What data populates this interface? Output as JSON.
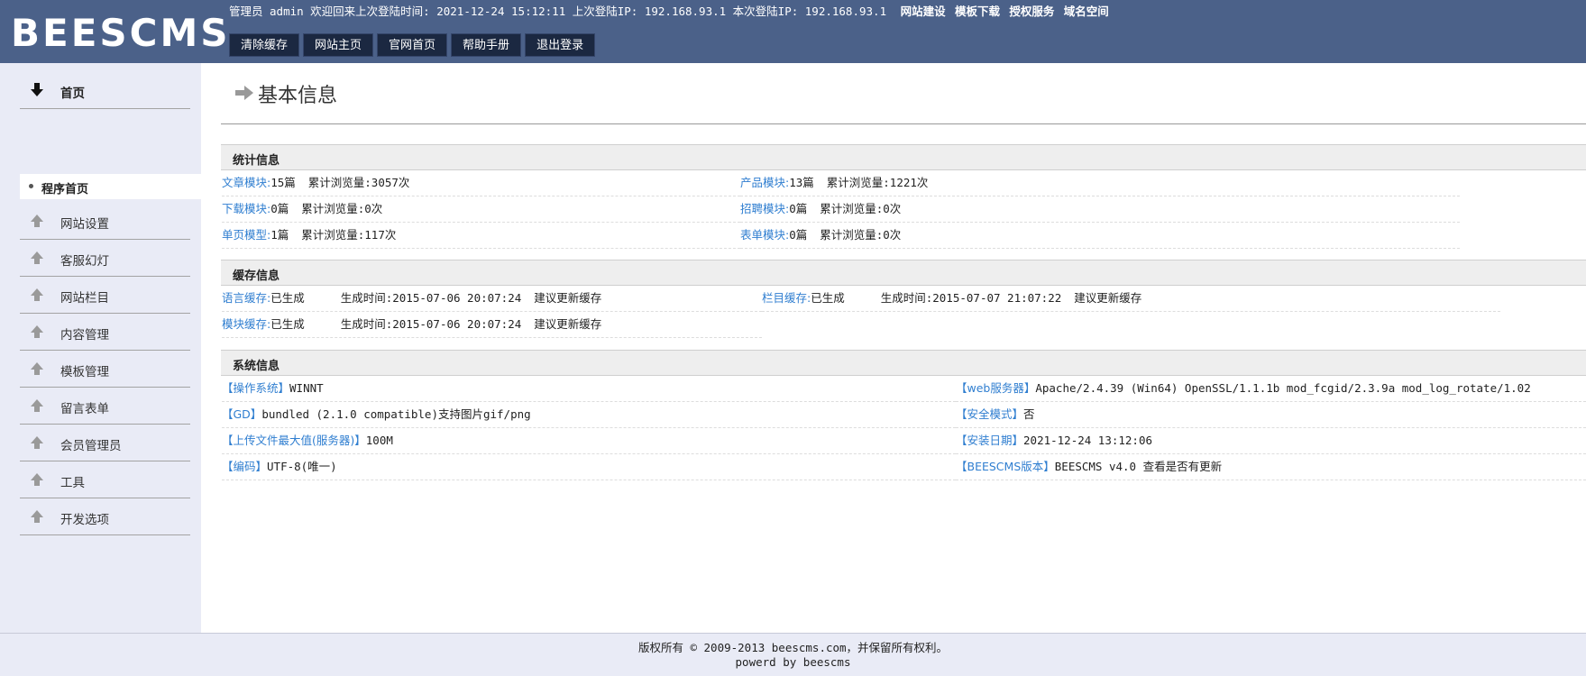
{
  "header": {
    "logo": "BEESCMS",
    "login_info": "管理员 admin 欢迎回来上次登陆时间: 2021-12-24 15:12:11 上次登陆IP: 192.168.93.1 本次登陆IP: 192.168.93.1",
    "links": [
      "网站建设",
      "模板下载",
      "授权服务",
      "域名空间"
    ],
    "buttons": [
      "清除缓存",
      "网站主页",
      "官网首页",
      "帮助手册",
      "退出登录"
    ]
  },
  "sidebar": {
    "home": "首页",
    "sub": "程序首页",
    "items": [
      "网站设置",
      "客服幻灯",
      "网站栏目",
      "内容管理",
      "模板管理",
      "留言表单",
      "会员管理员",
      "工具",
      "开发选项"
    ]
  },
  "main": {
    "title": "基本信息",
    "stats": {
      "heading": "统计信息",
      "rows": [
        {
          "k": "文章模块:",
          "count": "15篇",
          "views": "累计浏览量:3057次"
        },
        {
          "k": "产品模块:",
          "count": "13篇",
          "views": "累计浏览量:1221次"
        },
        {
          "k": "下载模块:",
          "count": "0篇",
          "views": "累计浏览量:0次"
        },
        {
          "k": "招聘模块:",
          "count": "0篇",
          "views": "累计浏览量:0次"
        },
        {
          "k": "单页模型:",
          "count": "1篇",
          "views": "累计浏览量:117次"
        },
        {
          "k": "表单模块:",
          "count": "0篇",
          "views": "累计浏览量:0次"
        }
      ]
    },
    "cache": {
      "heading": "缓存信息",
      "rows": [
        {
          "k": "语言缓存:",
          "status": "已生成",
          "time": "生成时间:2015-07-06 20:07:24",
          "tip": "建议更新缓存"
        },
        {
          "k": "栏目缓存:",
          "status": "已生成",
          "time": "生成时间:2015-07-07 21:07:22",
          "tip": "建议更新缓存"
        },
        {
          "k": "模块缓存:",
          "status": "已生成",
          "time": "生成时间:2015-07-06 20:07:24",
          "tip": "建议更新缓存"
        }
      ]
    },
    "system": {
      "heading": "系统信息",
      "rows": [
        {
          "k": "【操作系统】",
          "v": "WINNT"
        },
        {
          "k": "【web服务器】",
          "v": "Apache/2.4.39 (Win64) OpenSSL/1.1.1b mod_fcgid/2.3.9a mod_log_rotate/1.02"
        },
        {
          "k": "【GD】",
          "v": "bundled (2.1.0 compatible)支持图片gif/png"
        },
        {
          "k": "【安全模式】",
          "v": "否"
        },
        {
          "k": "【上传文件最大值(服务器)】",
          "v": "100M"
        },
        {
          "k": "【安装日期】",
          "v": "2021-12-24 13:12:06"
        },
        {
          "k": "【编码】",
          "v": "UTF-8(唯一)"
        },
        {
          "k": "【BEESCMS版本】",
          "v": "BEESCMS v4.0  查看是否有更新"
        }
      ]
    }
  },
  "footer": {
    "line1": "版权所有 © 2009-2013 beescms.com，并保留所有权利。",
    "line2": "powerd by beescms"
  }
}
